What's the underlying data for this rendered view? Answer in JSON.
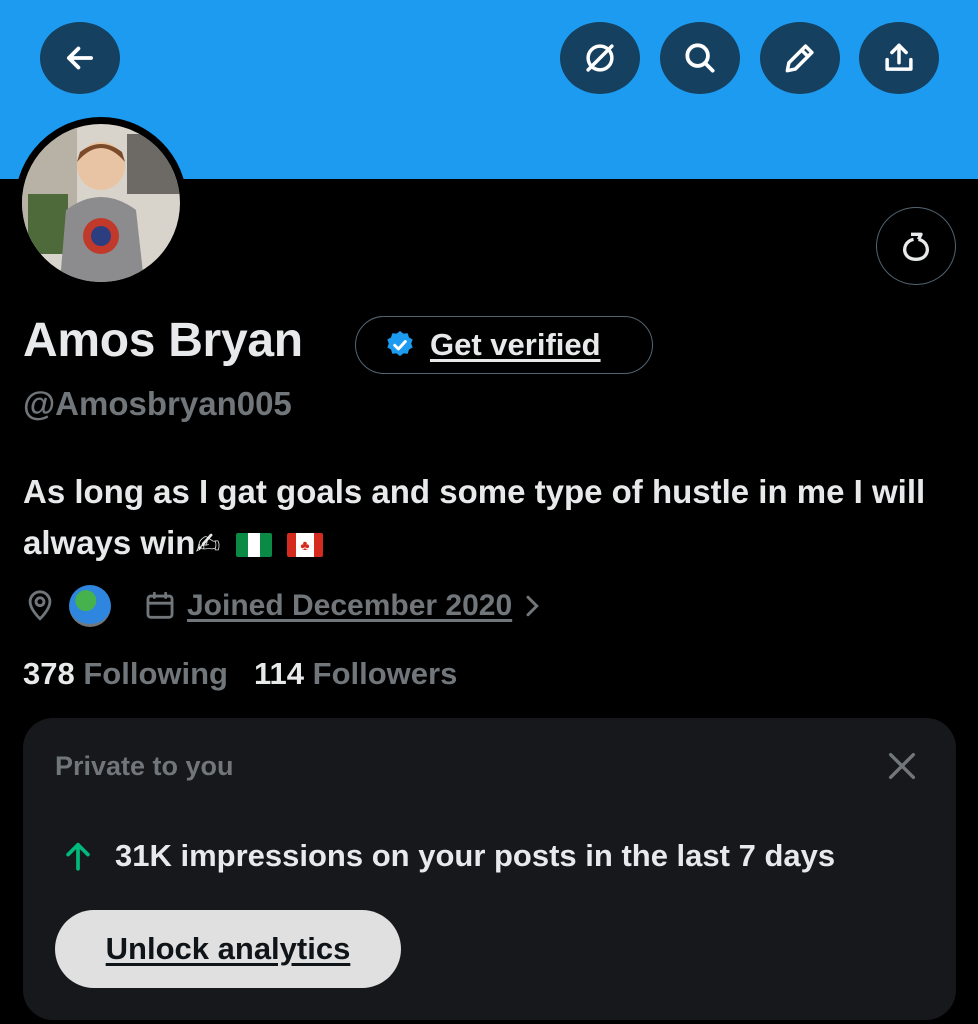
{
  "header": {
    "back_icon": "arrow-left-icon",
    "actions": [
      "grok-icon",
      "search-icon",
      "pencil-icon",
      "share-icon"
    ]
  },
  "profile": {
    "name": "Amos Bryan",
    "verify_label": "Get verified",
    "handle": "@Amosbryan005",
    "bio_text": "As long as I gat goals and some type of hustle in me I will always win",
    "bio_emoji": "✍",
    "location_icon": "location-pin-icon",
    "location_emoji": "globe-icon",
    "joined": "Joined December 2020",
    "following_count": "378",
    "following_label": "Following",
    "followers_count": "114",
    "followers_label": "Followers"
  },
  "private_card": {
    "title": "Private to you",
    "impressions_text": "31K impressions on your posts in the last 7 days",
    "unlock_label": "Unlock analytics"
  },
  "colors": {
    "banner": "#1d9bf0",
    "accent": "#1d9bf0",
    "muted": "#71767b",
    "up_arrow": "#00ba7c"
  }
}
